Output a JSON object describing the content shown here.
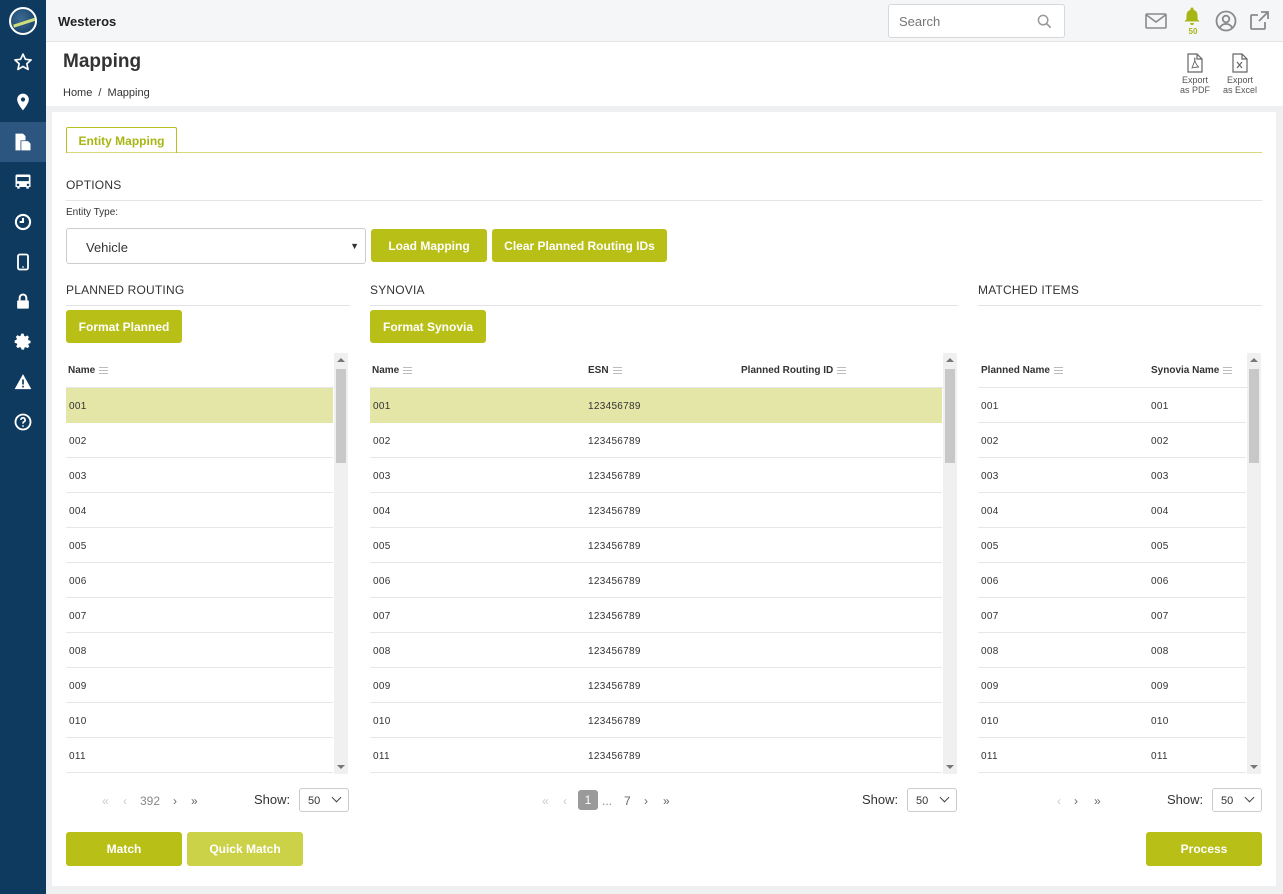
{
  "app": {
    "title": "Westeros"
  },
  "search": {
    "placeholder": "Search"
  },
  "notifications": {
    "count": "50"
  },
  "page": {
    "title": "Mapping",
    "breadcrumb_home": "Home",
    "breadcrumb_sep": "/",
    "breadcrumb_current": "Mapping"
  },
  "exports": [
    {
      "line1": "Export",
      "line2": "as PDF"
    },
    {
      "line1": "Export",
      "line2": "as Excel"
    }
  ],
  "tabs": [
    {
      "label": "Entity Mapping",
      "active": true
    }
  ],
  "options": {
    "heading": "OPTIONS",
    "entity_type_label": "Entity Type:",
    "entity_type_value": "Vehicle"
  },
  "buttons": {
    "load_mapping": "Load Mapping",
    "clear_planned": "Clear Planned Routing IDs",
    "format_planned": "Format Planned",
    "format_synovia": "Format Synovia",
    "match": "Match",
    "quick_match": "Quick Match",
    "process": "Process"
  },
  "planned": {
    "heading": "PLANNED ROUTING",
    "columns": [
      "Name"
    ],
    "rows": [
      "001",
      "002",
      "003",
      "004",
      "005",
      "006",
      "007",
      "008",
      "009",
      "010",
      "011"
    ],
    "selected_index": 0,
    "pager": {
      "page": "392",
      "show_label": "Show:",
      "show_value": "50"
    }
  },
  "synovia": {
    "heading": "SYNOVIA",
    "columns": [
      "Name",
      "ESN",
      "Planned Routing ID"
    ],
    "rows": [
      {
        "name": "001",
        "esn": "123456789",
        "prid": ""
      },
      {
        "name": "002",
        "esn": "123456789",
        "prid": ""
      },
      {
        "name": "003",
        "esn": "123456789",
        "prid": ""
      },
      {
        "name": "004",
        "esn": "123456789",
        "prid": ""
      },
      {
        "name": "005",
        "esn": "123456789",
        "prid": ""
      },
      {
        "name": "006",
        "esn": "123456789",
        "prid": ""
      },
      {
        "name": "007",
        "esn": "123456789",
        "prid": ""
      },
      {
        "name": "008",
        "esn": "123456789",
        "prid": ""
      },
      {
        "name": "009",
        "esn": "123456789",
        "prid": ""
      },
      {
        "name": "010",
        "esn": "123456789",
        "prid": ""
      },
      {
        "name": "011",
        "esn": "123456789",
        "prid": ""
      }
    ],
    "selected_index": 0,
    "pager": {
      "current": "1",
      "ellipsis": "...",
      "last": "7",
      "show_label": "Show:",
      "show_value": "50"
    }
  },
  "matched": {
    "heading": "MATCHED ITEMS",
    "columns": [
      "Planned Name",
      "Synovia Name"
    ],
    "rows": [
      {
        "planned": "001",
        "synovia": "001"
      },
      {
        "planned": "002",
        "synovia": "002"
      },
      {
        "planned": "003",
        "synovia": "003"
      },
      {
        "planned": "004",
        "synovia": "004"
      },
      {
        "planned": "005",
        "synovia": "005"
      },
      {
        "planned": "006",
        "synovia": "006"
      },
      {
        "planned": "007",
        "synovia": "007"
      },
      {
        "planned": "008",
        "synovia": "008"
      },
      {
        "planned": "009",
        "synovia": "009"
      },
      {
        "planned": "010",
        "synovia": "010"
      },
      {
        "planned": "011",
        "synovia": "011"
      }
    ],
    "pager": {
      "show_label": "Show:",
      "show_value": "50"
    }
  },
  "colors": {
    "accent": "#b8bf16",
    "sidebar": "#0f3a5f",
    "selected_row": "#e3e6a6"
  },
  "sidebar_icons": [
    "star-icon",
    "map-pin-icon",
    "documents-icon",
    "bus-icon",
    "clock-icon",
    "tablet-icon",
    "lock-icon",
    "gear-icon",
    "warning-icon",
    "help-icon"
  ]
}
